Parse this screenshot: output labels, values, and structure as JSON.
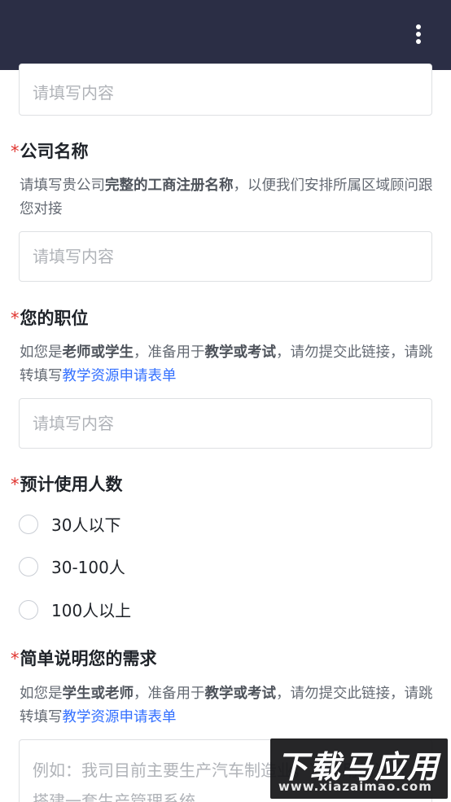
{
  "form": {
    "placeholder": "请填写内容",
    "q_company": {
      "title": "公司名称",
      "desc_pre": "请填写贵公司",
      "desc_bold": "完整的工商注册名称",
      "desc_post": "，以便我们安排所属区域顾问跟您对接"
    },
    "q_position": {
      "title": "您的职位",
      "desc_pre": "如您是",
      "desc_bold1": "老师或学生",
      "desc_mid": "，准备用于",
      "desc_bold2": "教学或考试",
      "desc_post": "，请勿提交此链接，请跳转填写",
      "desc_link": "教学资源申请表单"
    },
    "q_users": {
      "title": "预计使用人数",
      "options": [
        "30人以下",
        "30-100人",
        "100人以上"
      ]
    },
    "q_needs": {
      "title": "简单说明您的需求",
      "desc_pre": "如您是",
      "desc_bold1": "学生或老师",
      "desc_mid": "，准备用于",
      "desc_bold2": "教学或考试",
      "desc_post": "，请勿提交此链接，请跳转填写",
      "desc_link": "教学资源申请表单",
      "placeholder": "例如：我司目前主要生产汽车制造业，准备用简道云搭建一套生产管理系统"
    },
    "required_mark": "*"
  },
  "watermark": {
    "main": "下载马应用",
    "sub": "www.xiazaimao.com"
  }
}
